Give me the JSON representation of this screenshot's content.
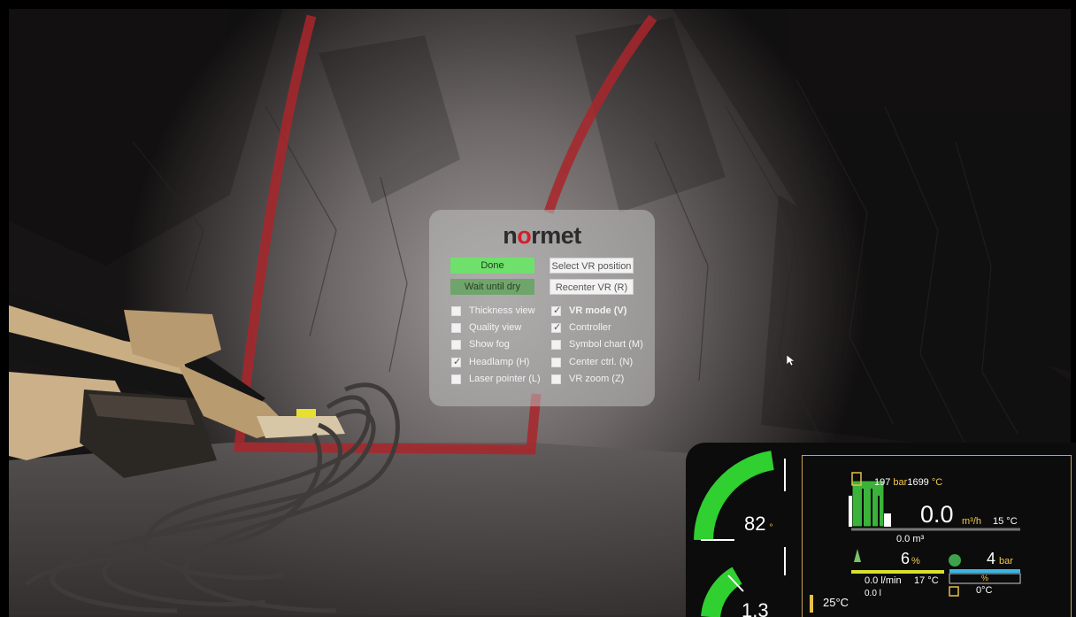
{
  "brand": {
    "logo_prefix": "n",
    "logo_accent": "o",
    "logo_suffix": "rmet",
    "accent_color": "#d21f2a"
  },
  "buttons": {
    "done": "Done",
    "wait_until_dry": "Wait until dry",
    "select_vr_position": "Select VR position",
    "recenter_vr": "Recenter VR (R)"
  },
  "options_left": [
    {
      "label": "Thickness view",
      "checked": false
    },
    {
      "label": "Quality view",
      "checked": false
    },
    {
      "label": "Show fog",
      "checked": false
    },
    {
      "label": "Headlamp (H)",
      "checked": true
    },
    {
      "label": "Laser pointer (L)",
      "checked": false
    }
  ],
  "options_right": [
    {
      "label": "VR mode (V)",
      "checked": true
    },
    {
      "label": "Controller",
      "checked": true
    },
    {
      "label": "Symbol chart (M)",
      "checked": false
    },
    {
      "label": "Center ctrl. (N)",
      "checked": false
    },
    {
      "label": "VR zoom (Z)",
      "checked": false
    }
  ],
  "dashboard": {
    "gauge_top": {
      "value": "82",
      "unit": "°"
    },
    "gauge_bottom": {
      "value": "1.3"
    },
    "pump": {
      "pressure": "197",
      "pressure_unit": "bar",
      "temp": "1699",
      "temp_unit": "°C"
    },
    "flow": {
      "value": "0.0",
      "unit": "m³/h",
      "temp": "15 °C"
    },
    "volume": "0.0 m³",
    "additive": {
      "percent": "6",
      "percent_unit": "%",
      "rate": "0.0 l/min",
      "temp": "17 °C",
      "total": "0.0 l"
    },
    "air": {
      "pressure": "4",
      "unit": "bar",
      "percent_unit": "%",
      "temp": "0°C"
    },
    "ambient_temp": "25°C"
  }
}
